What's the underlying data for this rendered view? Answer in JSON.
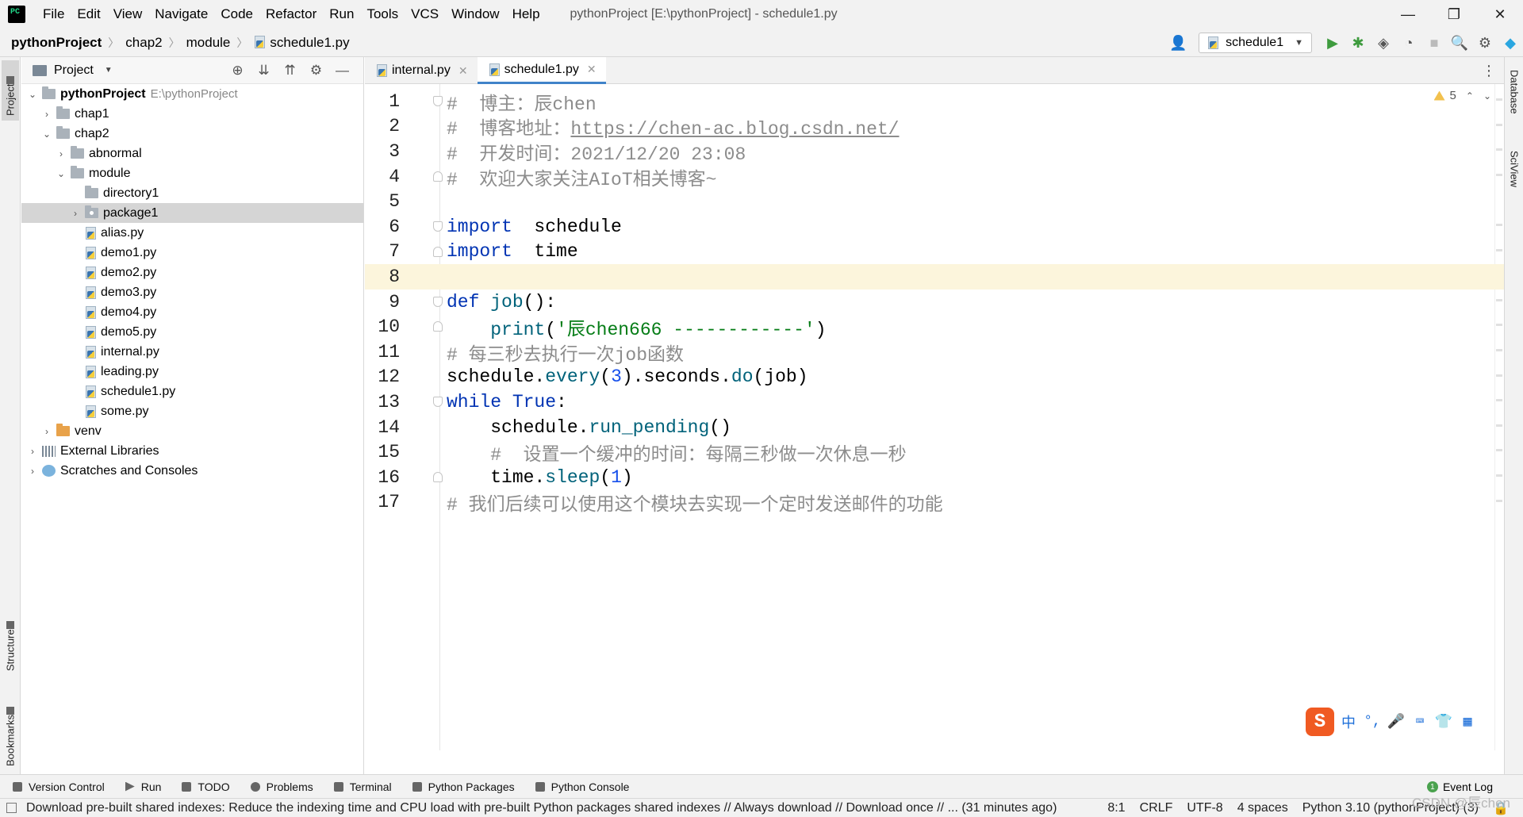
{
  "window": {
    "menus": [
      "File",
      "Edit",
      "View",
      "Navigate",
      "Code",
      "Refactor",
      "Run",
      "Tools",
      "VCS",
      "Window",
      "Help"
    ],
    "title": "pythonProject [E:\\pythonProject] - schedule1.py",
    "controls": [
      "—",
      "❐",
      "✕"
    ]
  },
  "breadcrumb": [
    "pythonProject",
    "chap2",
    "module",
    "schedule1.py"
  ],
  "run_config": "schedule1",
  "left_tabs": {
    "project": "Project",
    "structure": "Structure",
    "bookmarks": "Bookmarks"
  },
  "right_tabs": {
    "database": "Database",
    "sciview": "SciView"
  },
  "project_panel": {
    "title": "Project",
    "tree": [
      {
        "label": "pythonProject",
        "hint": "E:\\pythonProject",
        "arrow": "⌄",
        "icon": "folder"
      },
      {
        "label": "chap1",
        "arrow": "›",
        "icon": "folder"
      },
      {
        "label": "chap2",
        "arrow": "⌄",
        "icon": "folder"
      },
      {
        "label": "abnormal",
        "arrow": "›",
        "icon": "folder"
      },
      {
        "label": "module",
        "arrow": "⌄",
        "icon": "folder"
      },
      {
        "label": "directory1",
        "arrow": "",
        "icon": "folder"
      },
      {
        "label": "package1",
        "arrow": "›",
        "icon": "package"
      },
      {
        "label": "alias.py",
        "arrow": "",
        "icon": "python-file"
      },
      {
        "label": "demo1.py",
        "arrow": "",
        "icon": "python-file"
      },
      {
        "label": "demo2.py",
        "arrow": "",
        "icon": "python-file"
      },
      {
        "label": "demo3.py",
        "arrow": "",
        "icon": "python-file"
      },
      {
        "label": "demo4.py",
        "arrow": "",
        "icon": "python-file"
      },
      {
        "label": "demo5.py",
        "arrow": "",
        "icon": "python-file"
      },
      {
        "label": "internal.py",
        "arrow": "",
        "icon": "python-file"
      },
      {
        "label": "leading.py",
        "arrow": "",
        "icon": "python-file"
      },
      {
        "label": "schedule1.py",
        "arrow": "",
        "icon": "python-file"
      },
      {
        "label": "some.py",
        "arrow": "",
        "icon": "python-file"
      },
      {
        "label": "venv",
        "arrow": "›",
        "icon": "venv-folder"
      },
      {
        "label": "External Libraries",
        "arrow": "›",
        "icon": "library"
      },
      {
        "label": "Scratches and Consoles",
        "arrow": "›",
        "icon": "scratches"
      }
    ]
  },
  "tabs": [
    {
      "label": "internal.py",
      "active": false
    },
    {
      "label": "schedule1.py",
      "active": true
    }
  ],
  "inspection": {
    "warnings": "5"
  },
  "code_lines": [
    {
      "n": "1",
      "tokens": [
        {
          "t": "#  博主：辰chen",
          "c": "cm"
        }
      ]
    },
    {
      "n": "2",
      "tokens": [
        {
          "t": "#  博客地址：",
          "c": "cm"
        },
        {
          "t": "https://chen-ac.blog.csdn.net/",
          "c": "link"
        }
      ]
    },
    {
      "n": "3",
      "tokens": [
        {
          "t": "#  开发时间：2021/12/20 23:08",
          "c": "cm"
        }
      ]
    },
    {
      "n": "4",
      "tokens": [
        {
          "t": "#  欢迎大家关注AIoT相关博客~",
          "c": "cm"
        }
      ]
    },
    {
      "n": "5",
      "tokens": []
    },
    {
      "n": "6",
      "tokens": [
        {
          "t": "import",
          "c": "kw"
        },
        {
          "t": "  schedule",
          "c": "par"
        }
      ]
    },
    {
      "n": "7",
      "tokens": [
        {
          "t": "import",
          "c": "kw"
        },
        {
          "t": "  time",
          "c": "par"
        }
      ]
    },
    {
      "n": "8",
      "tokens": []
    },
    {
      "n": "9",
      "tokens": [
        {
          "t": "def ",
          "c": "kw"
        },
        {
          "t": "job",
          "c": "fn"
        },
        {
          "t": "():",
          "c": "par"
        }
      ]
    },
    {
      "n": "10",
      "tokens": [
        {
          "t": "    print",
          "c": "fn"
        },
        {
          "t": "(",
          "c": "par"
        },
        {
          "t": "'辰chen666 ------------'",
          "c": "str"
        },
        {
          "t": ")",
          "c": "par"
        }
      ]
    },
    {
      "n": "11",
      "tokens": [
        {
          "t": "# 每三秒去执行一次job函数",
          "c": "cm"
        }
      ]
    },
    {
      "n": "12",
      "tokens": [
        {
          "t": "schedule.",
          "c": "par"
        },
        {
          "t": "every",
          "c": "fn"
        },
        {
          "t": "(",
          "c": "par"
        },
        {
          "t": "3",
          "c": "num"
        },
        {
          "t": ").seconds.",
          "c": "par"
        },
        {
          "t": "do",
          "c": "fn"
        },
        {
          "t": "(job)",
          "c": "par"
        }
      ]
    },
    {
      "n": "13",
      "tokens": [
        {
          "t": "while ",
          "c": "kw"
        },
        {
          "t": "True",
          "c": "kw"
        },
        {
          "t": ":",
          "c": "par"
        }
      ]
    },
    {
      "n": "14",
      "tokens": [
        {
          "t": "    schedule.",
          "c": "par"
        },
        {
          "t": "run_pending",
          "c": "fn"
        },
        {
          "t": "()",
          "c": "par"
        }
      ]
    },
    {
      "n": "15",
      "tokens": [
        {
          "t": "    #  设置一个缓冲的时间：每隔三秒做一次休息一秒",
          "c": "cm"
        }
      ]
    },
    {
      "n": "16",
      "tokens": [
        {
          "t": "    time.",
          "c": "par"
        },
        {
          "t": "sleep",
          "c": "fn"
        },
        {
          "t": "(",
          "c": "par"
        },
        {
          "t": "1",
          "c": "num"
        },
        {
          "t": ")",
          "c": "par"
        }
      ]
    },
    {
      "n": "17",
      "tokens": [
        {
          "t": "# 我们后续可以使用这个模块去实现一个定时发送邮件的功能",
          "c": "cm"
        }
      ]
    }
  ],
  "ime": {
    "logo": "S",
    "items": [
      "中",
      "°,",
      "🎤",
      "⌨",
      "👕",
      "▦"
    ]
  },
  "tool_tabs": [
    {
      "label": "Version Control",
      "icon": "branch-icon"
    },
    {
      "label": "Run",
      "icon": "run-icon"
    },
    {
      "label": "TODO",
      "icon": "list-icon"
    },
    {
      "label": "Problems",
      "icon": "problems-icon"
    },
    {
      "label": "Terminal",
      "icon": "terminal-icon"
    },
    {
      "label": "Python Packages",
      "icon": "packages-icon"
    },
    {
      "label": "Python Console",
      "icon": "console-icon"
    }
  ],
  "event_log": {
    "count": "1",
    "label": "Event Log"
  },
  "status": {
    "message": "Download pre-built shared indexes: Reduce the indexing time and CPU load with pre-built Python packages shared indexes // Always download // Download once // ... (31 minutes ago)",
    "position": "8:1",
    "line_sep": "CRLF",
    "encoding": "UTF-8",
    "indent": "4 spaces",
    "interpreter": "Python 3.10 (pythonProject) (3)"
  },
  "watermark": "CSDN @辰chen"
}
